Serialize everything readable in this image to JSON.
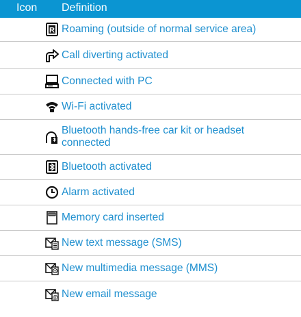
{
  "table": {
    "headers": {
      "icon": "Icon",
      "definition": "Definition"
    },
    "rows": [
      {
        "icon": "roaming-icon",
        "definition": "Roaming (outside of normal service area)"
      },
      {
        "icon": "call-divert-icon",
        "definition": "Call diverting activated"
      },
      {
        "icon": "pc-connection-icon",
        "definition": "Connected with PC"
      },
      {
        "icon": "wifi-icon",
        "definition": "Wi-Fi activated"
      },
      {
        "icon": "bluetooth-headset-icon",
        "definition": "Bluetooth hands-free car kit or headset connected"
      },
      {
        "icon": "bluetooth-icon",
        "definition": "Bluetooth activated"
      },
      {
        "icon": "alarm-icon",
        "definition": "Alarm activated"
      },
      {
        "icon": "memory-card-icon",
        "definition": "Memory card inserted"
      },
      {
        "icon": "sms-icon",
        "definition": "New text message (SMS)"
      },
      {
        "icon": "mms-icon",
        "definition": "New multimedia message (MMS)"
      },
      {
        "icon": "email-icon",
        "definition": "New email message"
      }
    ]
  },
  "colors": {
    "header_bg": "#0b95d2",
    "text": "#1e8fcf",
    "divider": "#c8c8c8"
  }
}
